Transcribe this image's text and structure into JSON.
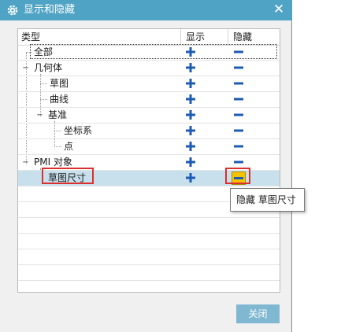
{
  "dialog": {
    "title": "显示和隐藏",
    "close_symbol": "✕",
    "icons": {
      "title": "gear-icon",
      "close": "close-icon",
      "show": "plus-icon",
      "hide": "minus-icon"
    },
    "colors": {
      "titlebar": "#4fa3c4",
      "show_icon": "#1e5bb5",
      "hide_icon": "#1e5bb5",
      "selected_row": "#c7e0ec",
      "highlight": "#d93030",
      "hide_active_bg": "#f5c400"
    }
  },
  "table": {
    "headers": {
      "type": "类型",
      "show": "显示",
      "hide": "隐藏"
    },
    "rows": [
      {
        "label": "全部"
      },
      {
        "label": "几何体"
      },
      {
        "label": "草图"
      },
      {
        "label": "曲线"
      },
      {
        "label": "基准"
      },
      {
        "label": "坐标系"
      },
      {
        "label": "点"
      },
      {
        "label": "PMI 对象"
      },
      {
        "label": "草图尺寸",
        "selected": true
      }
    ]
  },
  "tooltip": {
    "text": "隐藏 草图尺寸"
  },
  "buttons": {
    "close_label": "关闭"
  }
}
